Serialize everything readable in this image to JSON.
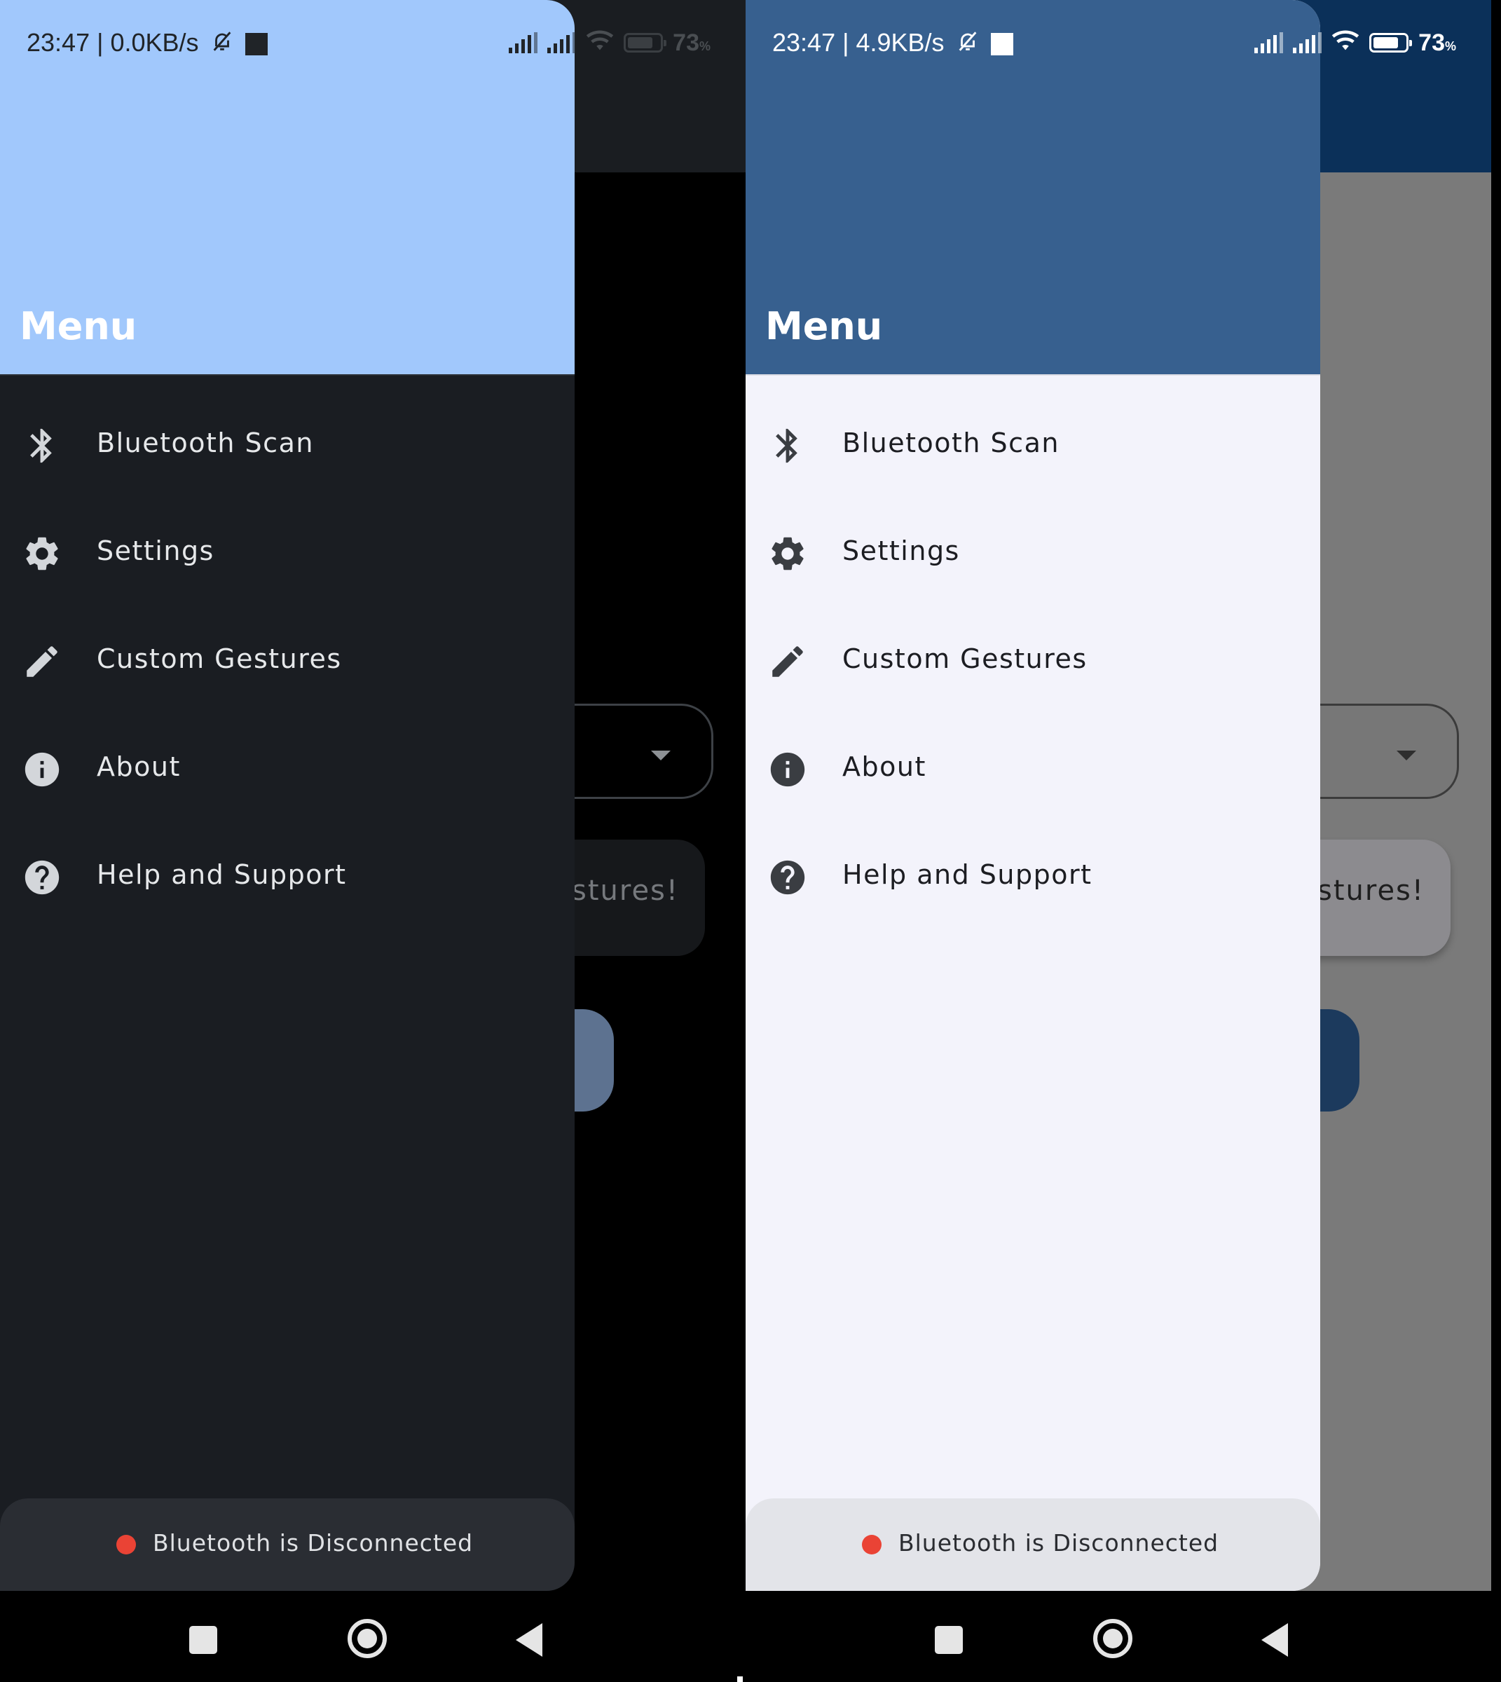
{
  "panels": [
    {
      "theme": "dark",
      "status": {
        "time": "23:47 | 0.0KB/s",
        "battery": "73",
        "battery_unit": "%"
      },
      "background": {
        "card_text": "stures!"
      },
      "drawer": {
        "title": "Menu",
        "items": [
          {
            "icon": "bluetooth-icon",
            "label": "Bluetooth Scan"
          },
          {
            "icon": "gear-icon",
            "label": "Settings"
          },
          {
            "icon": "pencil-icon",
            "label": "Custom Gestures"
          },
          {
            "icon": "info-icon",
            "label": "About"
          },
          {
            "icon": "help-icon",
            "label": "Help and Support"
          }
        ],
        "footer": {
          "status_text": "Bluetooth is Disconnected",
          "status_color": "#ea4335"
        }
      }
    },
    {
      "theme": "light",
      "status": {
        "time": "23:47 | 4.9KB/s",
        "battery": "73",
        "battery_unit": "%"
      },
      "background": {
        "card_text": "stures!"
      },
      "drawer": {
        "title": "Menu",
        "items": [
          {
            "icon": "bluetooth-icon",
            "label": "Bluetooth Scan"
          },
          {
            "icon": "gear-icon",
            "label": "Settings"
          },
          {
            "icon": "pencil-icon",
            "label": "Custom Gestures"
          },
          {
            "icon": "info-icon",
            "label": "About"
          },
          {
            "icon": "help-icon",
            "label": "Help and Support"
          }
        ],
        "footer": {
          "status_text": "Bluetooth is Disconnected",
          "status_color": "#ea4335"
        }
      }
    }
  ],
  "colors": {
    "dark_header": "#a1c8fc",
    "light_header": "#37608f",
    "status_dot": "#ea4335"
  }
}
